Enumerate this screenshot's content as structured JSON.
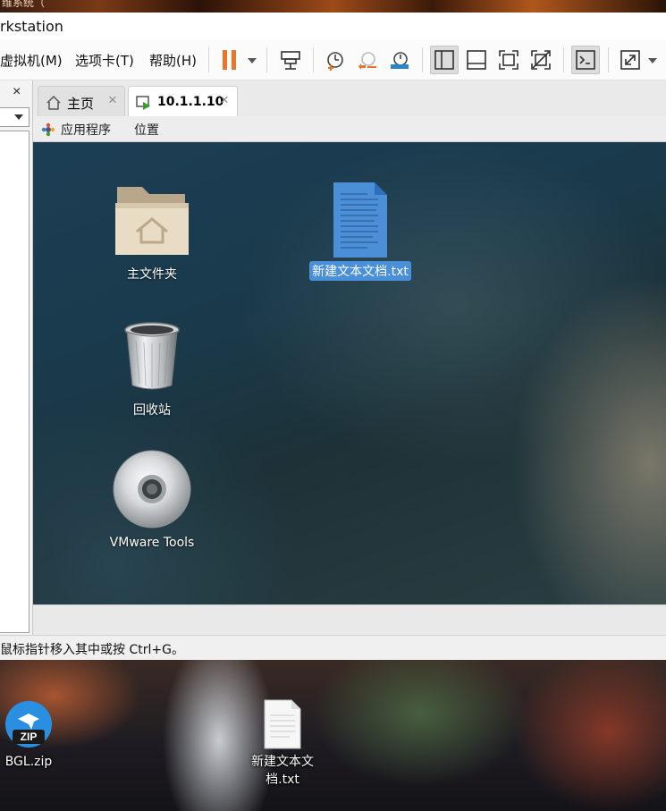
{
  "host": {
    "top_text": "维系统（",
    "desktop_icons": [
      {
        "label": "BGL.zip",
        "badge": "ZIP"
      },
      {
        "label_line1": "新建文本文",
        "label_line2": "档.txt"
      }
    ]
  },
  "window": {
    "title": "rkstation"
  },
  "menubar": {
    "items": [
      "虚拟机(M)",
      "选项卡(T)",
      "帮助(H)"
    ]
  },
  "toolbar": {
    "buttons": [
      "pause-icon",
      "send-ctrl-alt-del-icon",
      "snapshot-icon",
      "revert-snapshot-icon",
      "snapshot-manager-icon",
      "show-library-icon",
      "thumbnail-bar-icon",
      "fullscreen-icon",
      "unity-icon",
      "console-view-icon",
      "stretch-icon"
    ],
    "accent": "#e8752a"
  },
  "library": {
    "close_glyph": "×"
  },
  "tabs": [
    {
      "label": "主页",
      "icon": "home-icon",
      "active": false
    },
    {
      "label": "10.1.1.10",
      "icon": "vm-running-icon",
      "active": true
    }
  ],
  "guest": {
    "panel": {
      "apps": "应用程序",
      "places": "位置"
    },
    "icons": [
      {
        "label": "主文件夹",
        "type": "folder-home-icon"
      },
      {
        "label": "新建文本文档.txt",
        "type": "text-file-icon",
        "selected": true
      },
      {
        "label": "回收站",
        "type": "trash-icon"
      },
      {
        "label": "VMware Tools",
        "type": "cd-icon"
      }
    ],
    "selection_color": "#4a90d9"
  },
  "status": {
    "text": "鼠标指针移入其中或按 Ctrl+G。"
  }
}
